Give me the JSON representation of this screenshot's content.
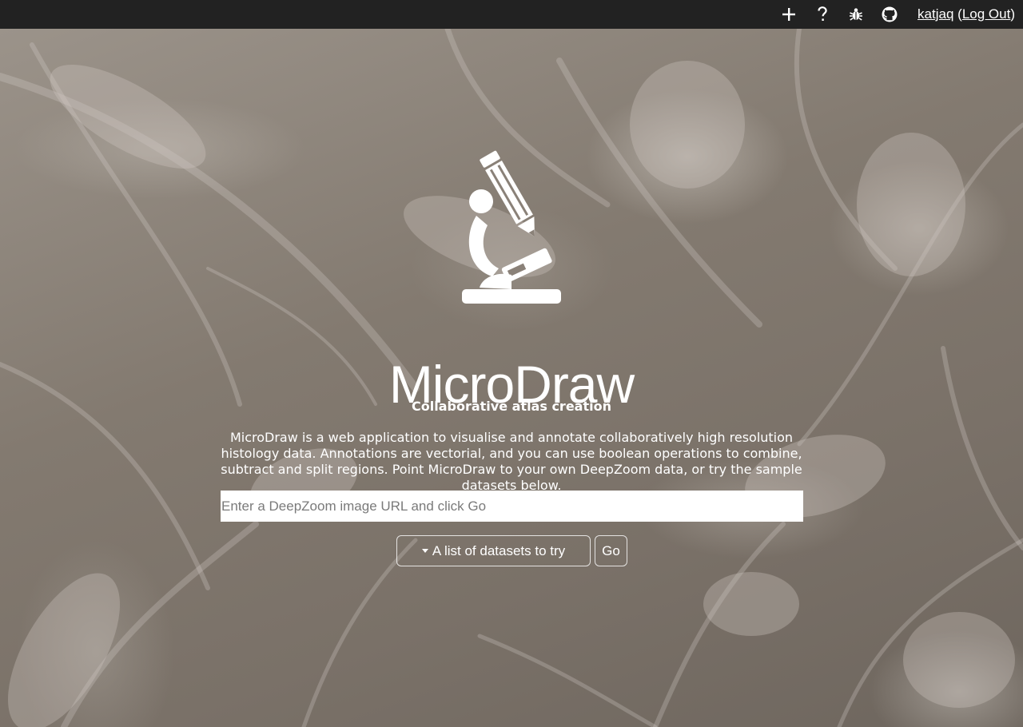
{
  "topbar": {
    "icons": [
      "plus-icon",
      "help-icon",
      "bug-icon",
      "github-icon"
    ],
    "user_name": "katjaq",
    "logout_open": "(",
    "logout_label": "Log Out",
    "logout_close": ")"
  },
  "hero": {
    "logo_icon": "microscope-pencil-icon",
    "title": "MicroDraw",
    "subtitle": "Collaborative atlas creation",
    "description": "MicroDraw is a web application to visualise and annotate collaboratively high resolution histology data. Annotations are vectorial, and you can use boolean operations to combine, subtract and split regions. Point MicroDraw to your own DeepZoom data, or try the sample datasets below."
  },
  "url_input": {
    "value": "",
    "placeholder": "Enter a DeepZoom image URL and click Go"
  },
  "datasets_dropdown": {
    "label": "A list of datasets to try",
    "icon": "caret-down-icon"
  },
  "go_button": {
    "label": "Go"
  },
  "colors": {
    "topbar": "#222222",
    "text": "#ffffff",
    "input_bg": "#ffffff"
  }
}
